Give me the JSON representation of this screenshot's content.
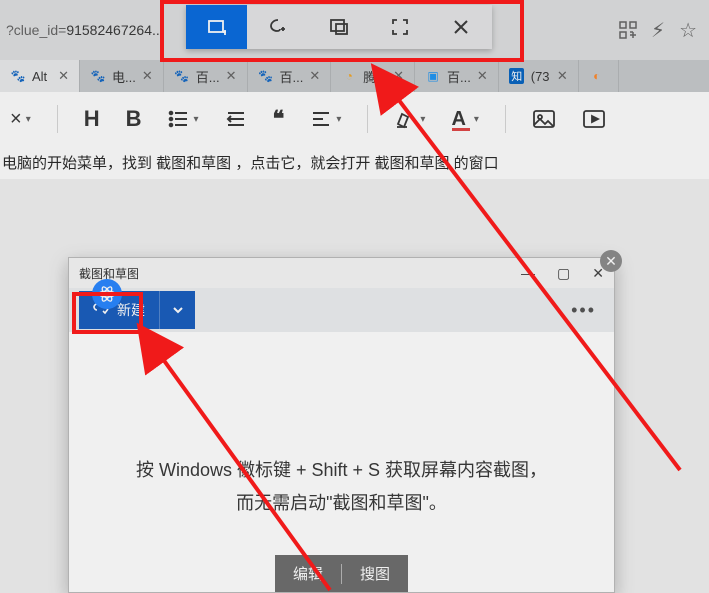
{
  "address_bar": {
    "url_prefix": "?clue_id=",
    "url_value": "91582467264..."
  },
  "tabs": {
    "active": {
      "label": "Alt"
    },
    "items": [
      {
        "label": "电..."
      },
      {
        "label": "百..."
      },
      {
        "label": "百..."
      },
      {
        "label": "腾..."
      },
      {
        "label": "百..."
      },
      {
        "label": "(73"
      }
    ]
  },
  "editor": {
    "font_default": "×",
    "heading": "H",
    "bold": "B",
    "quote": "❝",
    "letter_a": "A"
  },
  "body_line": "电脑的开始菜单，找到 截图和草图 ，点击它，就会打开 截图和草图 的窗口",
  "snip_window": {
    "title": "截图和草图",
    "new_label": "新建",
    "tip_line1": "按 Windows 徽标键 + Shift + S 获取屏幕内容截图，",
    "tip_line2": "而无需启动\"截图和草图\"。",
    "pill_left": "编辑",
    "pill_right": "搜图"
  }
}
